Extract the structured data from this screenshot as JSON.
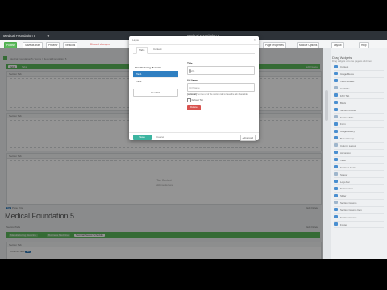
{
  "app": {
    "window_title": "Medical Foundation 5",
    "page_heading": "Medical Foundation 5"
  },
  "toolbar": {
    "save_label": "Publish",
    "btn2": "Save as draft",
    "btn3": "Preview",
    "btn4": "Versions",
    "link_text": "Discard changes",
    "right_btn1": "Page Properties",
    "right_btn2": "Module Options",
    "right_btn3": "Layout",
    "right_btn4": "Help"
  },
  "main": {
    "breadcrumb": "Medical Foundation 5 / Home / Medical Foundation 5",
    "tabs_bar_right": "Edit  Delete",
    "section1_header": "Section Tab",
    "section2_header": "Section Tab",
    "section3_header": "Section Tab",
    "section3_center": "Tab Content",
    "section3_center_sub": "Add module here",
    "line_label": "Page Title",
    "line_right": "Edit  Delete",
    "bottom_line_label": "Section Tabs",
    "bottom_line_right": "Edit  Delete",
    "bottom_section_header": "Section Tab",
    "bottom_item": "Column Tabs",
    "badge_text": "Tab"
  },
  "tagbar": {
    "chips": [
      "Manufacturing Medicine",
      "Business Medicine",
      "Seminar Series Schedule"
    ],
    "active_index": 2
  },
  "right_panel": {
    "title": "Drag Widgets",
    "subtitle": "Drag widgets onto the page to add them",
    "items": [
      "Content",
      "Image/Media",
      "Video Header",
      "Card/Tile",
      "FAQ Tab",
      "Block",
      "Section Module",
      "Section Tabs",
      "Form",
      "Image Gallery",
      "Button Group",
      "Column Layout",
      "Accordion",
      "Table",
      "Section Header",
      "Spacer",
      "Logo Bar",
      "Testimonials",
      "Slider",
      "Section Column",
      "Section Column Item",
      "Section Column",
      "Footer"
    ]
  },
  "modal": {
    "title": "Layout",
    "tabs": [
      "Tabs",
      "Content"
    ],
    "left_heading": "Manufacturing Medicine",
    "left_items": [
      "Tab1",
      "Tab2"
    ],
    "left_active_index": 0,
    "new_tab_label": "New Tab",
    "title_label": "Title",
    "title_value": "Tab1",
    "url_label": "Url Name",
    "url_placeholder": "Url Name",
    "help_bold": "(optional)",
    "help_text": "Set the url of the section tab to have the tab shareable",
    "default_tab_label": "Default Tab",
    "delete_label": "Delete",
    "save_label": "Save",
    "cancel_label": "Cancel",
    "advanced_label": "Advanced"
  },
  "colors": {
    "accent_green": "#5cb85c",
    "active_blue": "#2f7fc1",
    "delete_red": "#d9534f",
    "save_teal": "#3cb4a0"
  }
}
